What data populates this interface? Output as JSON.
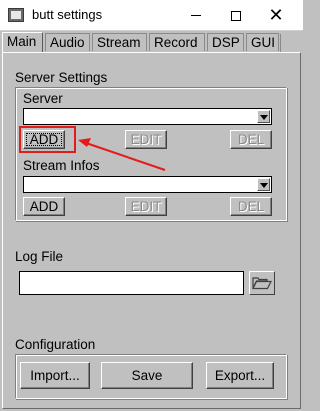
{
  "window": {
    "title": "butt settings"
  },
  "tabs": [
    "Main",
    "Audio",
    "Stream",
    "Record",
    "DSP",
    "GUI"
  ],
  "server_settings": {
    "heading": "Server Settings",
    "server": {
      "label": "Server",
      "value": "",
      "add": "ADD",
      "edit": "EDIT",
      "del": "DEL"
    },
    "stream_infos": {
      "label": "Stream Infos",
      "value": "",
      "add": "ADD",
      "edit": "EDIT",
      "del": "DEL"
    }
  },
  "log_file": {
    "heading": "Log File",
    "value": ""
  },
  "configuration": {
    "heading": "Configuration",
    "import": "Import...",
    "save": "Save",
    "export": "Export..."
  },
  "annotation": {
    "color": "#e21b1b"
  },
  "icons": {
    "folder": "folder-open-icon",
    "close": "close-icon",
    "minimize": "minimize-icon",
    "maximize": "maximize-icon"
  }
}
